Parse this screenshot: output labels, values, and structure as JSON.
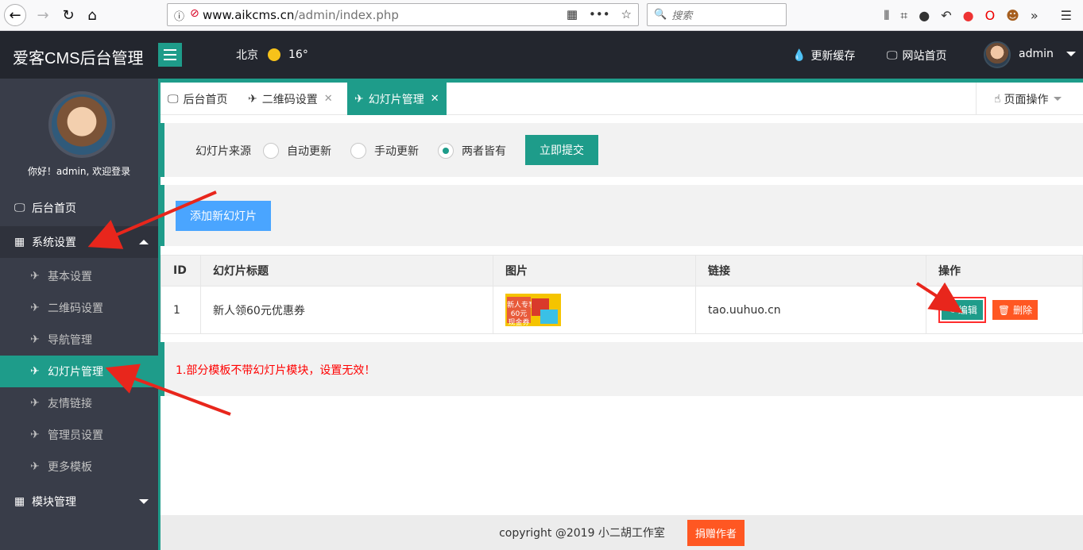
{
  "browser": {
    "url_host": "www.aikcms.cn",
    "url_path": "/admin/index.php",
    "search_placeholder": "搜索",
    "icons": [
      "back-icon",
      "forward-icon",
      "reload-icon",
      "home-icon",
      "info-icon",
      "tracking-icon",
      "qr-icon",
      "more-icon",
      "star-icon",
      "library-icon",
      "crop-icon",
      "chat-icon",
      "undo-icon",
      "location-icon",
      "opera-icon",
      "monkey-icon",
      "overflow-icon",
      "menu-icon"
    ]
  },
  "header": {
    "title": "爱客CMS后台管理",
    "city": "北京",
    "temperature": "16°",
    "refresh_cache": "更新缓存",
    "site_home": "网站首页",
    "user": "admin",
    "accent": "#1e9c8a"
  },
  "sidebar": {
    "welcome": "你好！admin, 欢迎登录",
    "items": [
      {
        "label": "后台首页"
      },
      {
        "label": "系统设置"
      },
      {
        "label": "基本设置"
      },
      {
        "label": "二维码设置"
      },
      {
        "label": "导航管理"
      },
      {
        "label": "幻灯片管理"
      },
      {
        "label": "友情链接"
      },
      {
        "label": "管理员设置"
      },
      {
        "label": "更多模板"
      },
      {
        "label": "模块管理"
      }
    ]
  },
  "tabs": {
    "items": [
      {
        "label": "后台首页"
      },
      {
        "label": "二维码设置"
      },
      {
        "label": "幻灯片管理"
      }
    ],
    "close_glyph": "✕",
    "page_ops": "页面操作"
  },
  "source": {
    "label": "幻灯片来源",
    "options": [
      "自动更新",
      "手动更新",
      "两者皆有"
    ],
    "selected": "两者皆有",
    "submit": "立即提交"
  },
  "add_button": "添加新幻灯片",
  "table": {
    "headers": [
      "ID",
      "幻灯片标题",
      "图片",
      "链接",
      "操作"
    ],
    "rows": [
      {
        "id": "1",
        "title": "新人领60元优惠券",
        "image_text": "新人专享\n60元\n现金券",
        "link": "tao.uuhuo.cn",
        "edit": "编辑",
        "delete": "删除"
      }
    ]
  },
  "notice": "1.部分模板不带幻灯片模块，设置无效！",
  "footer": {
    "copyright": "copyright @2019 小二胡工作室",
    "donate": "捐赠作者"
  }
}
